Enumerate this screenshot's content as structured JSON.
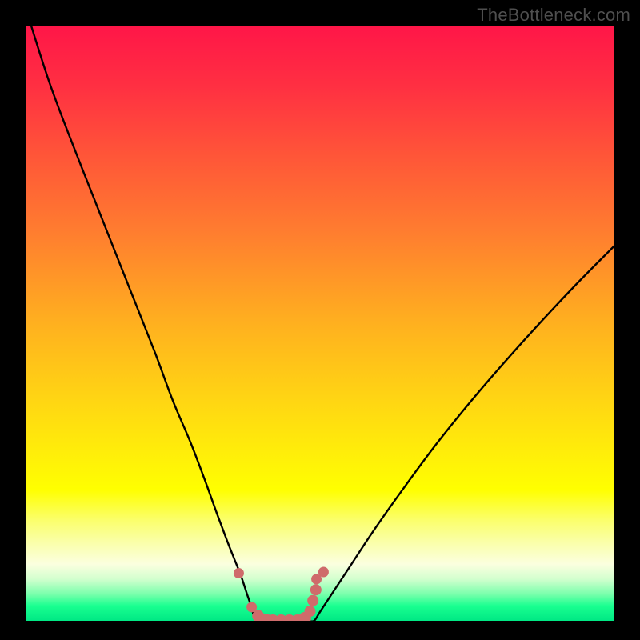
{
  "watermark": "TheBottleneck.com",
  "colors": {
    "frame": "#000000",
    "curve": "#000000",
    "marker": "#cf6b6b",
    "gradient_stops": [
      {
        "offset": 0.0,
        "color": "#ff1648"
      },
      {
        "offset": 0.1,
        "color": "#ff2f42"
      },
      {
        "offset": 0.22,
        "color": "#ff5638"
      },
      {
        "offset": 0.35,
        "color": "#ff7e2f"
      },
      {
        "offset": 0.5,
        "color": "#ffb01f"
      },
      {
        "offset": 0.62,
        "color": "#ffd314"
      },
      {
        "offset": 0.73,
        "color": "#fff108"
      },
      {
        "offset": 0.78,
        "color": "#ffff00"
      },
      {
        "offset": 0.83,
        "color": "#fbff6a"
      },
      {
        "offset": 0.87,
        "color": "#faffac"
      },
      {
        "offset": 0.905,
        "color": "#fbffdf"
      },
      {
        "offset": 0.93,
        "color": "#d2ffce"
      },
      {
        "offset": 0.955,
        "color": "#7affac"
      },
      {
        "offset": 0.975,
        "color": "#19ff90"
      },
      {
        "offset": 1.0,
        "color": "#00e884"
      }
    ]
  },
  "chart_data": {
    "type": "line",
    "title": "",
    "xlabel": "",
    "ylabel": "",
    "xlim": [
      0,
      100
    ],
    "ylim": [
      0,
      100
    ],
    "note": "Bottleneck-style V-curve. X is an implicit parameter axis (0-100); Y is mismatch percentage (0 = ideal, 100 = worst). Values approximated from pixel positions.",
    "series": [
      {
        "name": "left",
        "x": [
          0.0,
          4.2,
          9.2,
          14.0,
          18.0,
          22.0,
          25.0,
          28.0,
          30.5,
          32.5,
          34.2,
          35.4,
          36.6,
          37.6,
          38.4,
          39.0
        ],
        "y": [
          103.0,
          90.0,
          77.0,
          65.0,
          55.0,
          45.0,
          37.0,
          30.0,
          23.5,
          18.0,
          13.5,
          10.5,
          7.5,
          4.5,
          2.2,
          0.0
        ]
      },
      {
        "name": "bottom",
        "x": [
          39.0,
          40.0,
          41.0,
          42.0,
          43.0,
          44.0,
          45.0,
          46.0,
          47.0,
          48.0,
          49.0
        ],
        "y": [
          0.0,
          0.0,
          0.0,
          0.0,
          0.0,
          0.0,
          0.0,
          0.0,
          0.0,
          0.0,
          0.0
        ]
      },
      {
        "name": "right",
        "x": [
          49.0,
          50.0,
          52.0,
          55.0,
          59.0,
          64.0,
          70.0,
          77.0,
          85.0,
          93.0,
          100.0
        ],
        "y": [
          0.0,
          1.5,
          4.5,
          9.0,
          15.0,
          22.0,
          30.0,
          38.5,
          47.5,
          56.0,
          63.0
        ]
      }
    ],
    "markers": {
      "name": "highlight-points",
      "x": [
        36.2,
        38.4,
        39.5,
        40.8,
        42.0,
        43.4,
        44.8,
        46.2,
        47.4,
        48.3,
        48.8,
        49.3,
        49.4,
        50.6
      ],
      "y": [
        8.0,
        2.3,
        0.8,
        0.2,
        0.0,
        0.0,
        0.0,
        0.0,
        0.4,
        1.6,
        3.4,
        5.2,
        7.0,
        8.2
      ],
      "r": [
        6.5,
        6.5,
        7.5,
        7.5,
        8.0,
        8.0,
        8.0,
        8.0,
        8.0,
        7.0,
        7.0,
        7.0,
        6.5,
        6.5
      ]
    }
  }
}
